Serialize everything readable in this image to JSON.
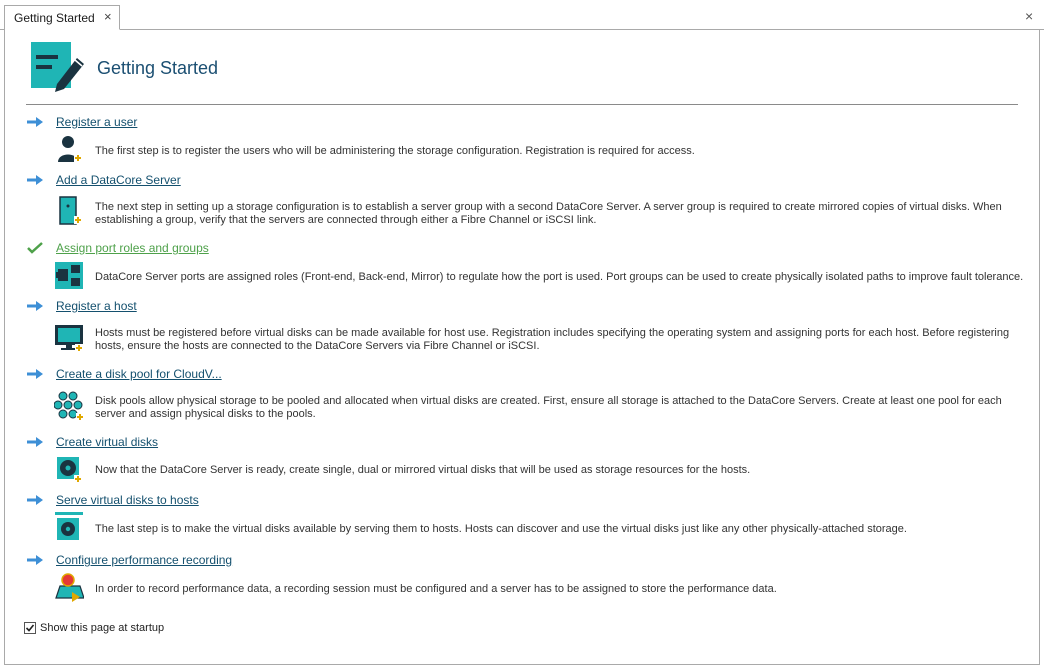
{
  "tab": {
    "label": "Getting Started",
    "close_glyph": "×"
  },
  "window": {
    "close_glyph": "×"
  },
  "header": {
    "title": "Getting Started",
    "icon": "notepad-pen-icon"
  },
  "colors": {
    "accent": "#1fb5b5",
    "dark": "#1a3340",
    "link": "#14506e",
    "done_link": "#4ea14a",
    "arrow": "#3d8fd6"
  },
  "steps": [
    {
      "link": "Register a user",
      "status": "pending",
      "icon": "user-add-icon",
      "desc": "The first step is to register the users who will be administering the storage configuration.  Registration is required for access."
    },
    {
      "link": "Add a DataCore Server",
      "status": "pending",
      "icon": "server-icon",
      "desc": "The next step in setting up a storage configuration is to establish a server group with a second DataCore Server.  A server group is required to create mirrored copies of virtual disks.  When establishing a group, verify that the servers are connected through either a Fibre Channel or iSCSI link."
    },
    {
      "link": "Assign port roles and groups",
      "status": "done",
      "icon": "port-icon",
      "desc": "DataCore Server ports are assigned roles (Front-end, Back-end, Mirror) to regulate how the port is used.  Port groups can be used to create physically isolated paths to improve fault tolerance."
    },
    {
      "link": "Register a host",
      "status": "pending",
      "icon": "host-monitor-icon",
      "desc": "Hosts must be registered before virtual disks can be made available for host use.  Registration includes specifying the operating system and assigning ports for each host.  Before registering hosts, ensure the hosts are connected to the DataCore Servers via Fibre Channel or iSCSI."
    },
    {
      "link": "Create a disk pool for CloudV...",
      "status": "pending",
      "icon": "disk-pool-icon",
      "desc": "Disk pools allow physical storage to be pooled and allocated when virtual disks are created.  First, ensure all storage is attached to the DataCore Servers.  Create at least one pool for each server and assign physical disks to the pools."
    },
    {
      "link": "Create virtual disks",
      "status": "pending",
      "icon": "virtual-disk-icon",
      "desc": "Now that the DataCore Server is ready, create single, dual or mirrored virtual disks that will be used as storage resources for the hosts."
    },
    {
      "link": "Serve virtual disks to hosts",
      "status": "pending",
      "icon": "serve-disk-icon",
      "desc": "The last step is to make the virtual disks available by serving them to hosts. Hosts can discover and use the virtual disks just like any other physically-attached storage."
    },
    {
      "link": "Configure performance recording",
      "status": "pending",
      "icon": "performance-recording-icon",
      "desc": "In order to record performance data, a recording session must be configured and a server has to be assigned to store the performance data."
    }
  ],
  "footer": {
    "show_at_startup_label": "Show this page at startup",
    "show_at_startup": true
  }
}
